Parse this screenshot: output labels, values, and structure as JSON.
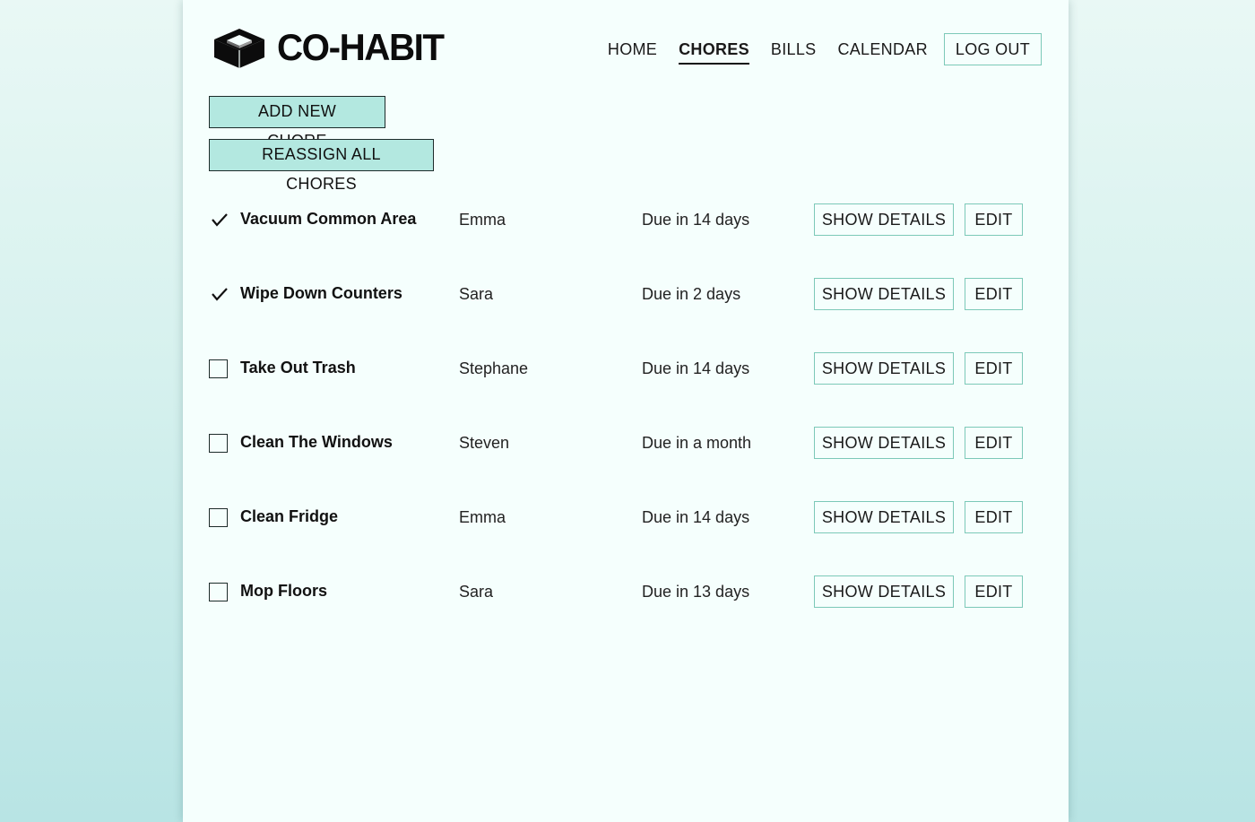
{
  "brand": {
    "name": "CO-HABIT",
    "logo_icon": "box-icon"
  },
  "nav": {
    "items": [
      {
        "label": "HOME",
        "active": false
      },
      {
        "label": "CHORES",
        "active": true
      },
      {
        "label": "BILLS",
        "active": false
      },
      {
        "label": "CALENDAR",
        "active": false
      }
    ],
    "logout_label": "LOG OUT"
  },
  "actions": {
    "add_label": "ADD NEW CHORE",
    "reassign_label": "REASSIGN ALL CHORES"
  },
  "chores": [
    {
      "name": "Vacuum Common Area",
      "assignee": "Emma",
      "due": "Due in 14 days",
      "done": true
    },
    {
      "name": "Wipe Down Counters",
      "assignee": "Sara",
      "due": "Due in 2 days",
      "done": true
    },
    {
      "name": "Take Out Trash",
      "assignee": "Stephane",
      "due": "Due in 14 days",
      "done": false
    },
    {
      "name": "Clean The Windows",
      "assignee": "Steven",
      "due": "Due in a month",
      "done": false
    },
    {
      "name": "Clean Fridge",
      "assignee": "Emma",
      "due": "Due in 14 days",
      "done": false
    },
    {
      "name": "Mop Floors",
      "assignee": "Sara",
      "due": "Due in 13 days",
      "done": false
    }
  ],
  "row_buttons": {
    "details_label": "SHOW DETAILS",
    "edit_label": "EDIT"
  },
  "colors": {
    "accent_fill": "#b3e8e0",
    "accent_border": "#7cc9b8",
    "page_background": "#f5fffd"
  }
}
